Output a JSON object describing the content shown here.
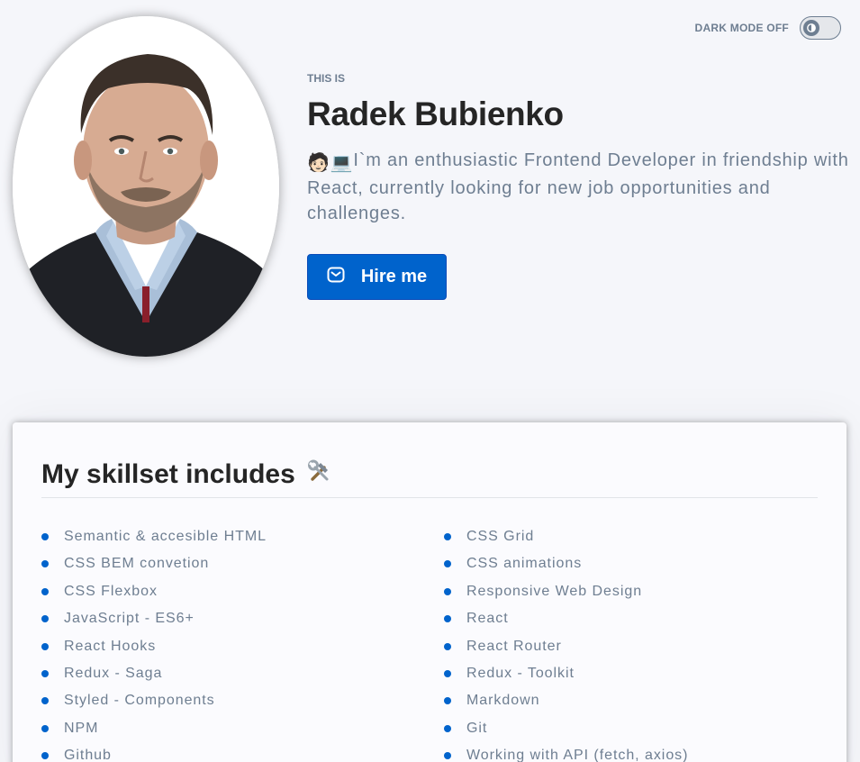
{
  "theme": {
    "label": "DARK MODE OFF"
  },
  "header": {
    "eyebrow": "THIS IS",
    "name": "Radek Bubienko",
    "description_emoji": "🧑🏻💻",
    "description": "I`m an enthusiastic Frontend Developer in friendship with React, currently looking for new job opportunities and challenges.",
    "hire_label": "Hire me"
  },
  "skills": {
    "title": "My skillset includes",
    "title_emoji": "🛠️",
    "items": [
      "Semantic & accesible HTML",
      "CSS Grid",
      "CSS BEM convetion",
      "CSS animations",
      "CSS Flexbox",
      "Responsive Web Design",
      "JavaScript - ES6+",
      "React",
      "React Hooks",
      "React Router",
      "Redux - Saga",
      "Redux - Toolkit",
      "Styled - Components",
      "Markdown",
      "NPM",
      "Git",
      "Github",
      "Working with API (fetch, axios)"
    ]
  },
  "colors": {
    "accent": "#0063cc",
    "text_muted": "#6e7e91",
    "text_dark": "#252525",
    "background": "#f5f6fa"
  },
  "icons": {
    "toggle": "sun-icon",
    "hire": "mail-icon",
    "skills": "hammer-wrench-icon"
  }
}
